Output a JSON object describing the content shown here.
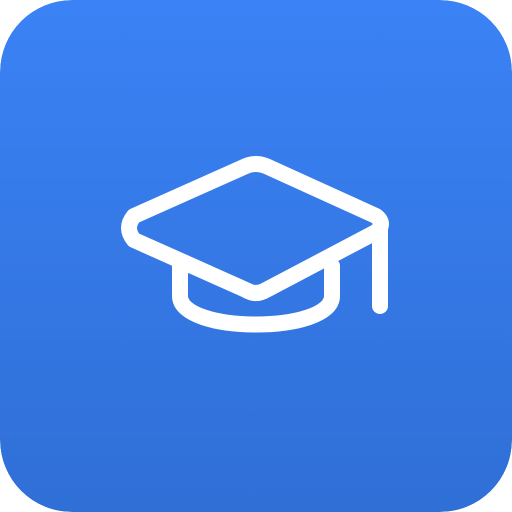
{
  "icon": {
    "name": "graduation-cap-icon",
    "colors": {
      "gradient_top": "#3b82f6",
      "gradient_bottom": "#2f6fd6",
      "stroke": "#ffffff"
    }
  }
}
